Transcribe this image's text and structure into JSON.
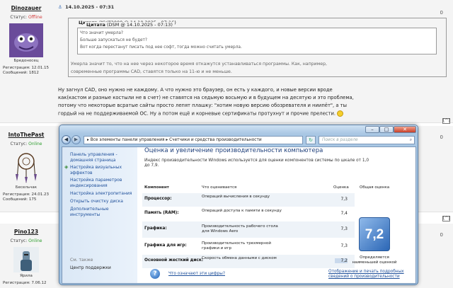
{
  "posts": [
    {
      "username": "Dinozauer",
      "status_label": "Статус:",
      "status_value": "Offline",
      "avatar_caption": "Бредоносец",
      "reg_label": "Регистрация:",
      "reg_date": "12.01.15",
      "msgs_label": "Сообщений:",
      "msgs": "1812",
      "number": "0",
      "date": "14.10.2025 - 07:31",
      "quote_outer_title": "Цитата",
      "quote_outer_meta": "(Kirill2000 @ 14.10.2025 - 07:16)",
      "quote_inner_title": "Цитата",
      "quote_inner_meta": "(DSM @ 14.10.2025 - 07:13)",
      "quote_inner_lines": [
        "Что значит умерла?",
        "Больше запускаться не будет?",
        "Вот когда перестанут писать под нее софт, тогда можно считать умерла."
      ],
      "quote_outer_lines": [
        "Умерла значит то, что на нее через некоторое время откажутся устанавливаться программы. Как, например,",
        "современные программы CAD, ставятся только на 11-ю и не меньше."
      ],
      "body_lines": [
        "Ну загнул CAD, оно нужно не каждому. А что нужно это браузер, он есть у каждого, и новые версии вроде",
        "как(кастом и разные костыли не в счет) не ставятся на седьмую восьмую и в будущем на десятую и это проблема,",
        "потому что некоторые всратые сайты просто лепят плашку: \"хотим новую версию обозревателя и ниипёт\", а ты",
        "гордый на не поддерживаемой ОС. Ну а потом ещё и корневые сертификаты протухнут и прочие прелести."
      ]
    },
    {
      "username": "IntoThePast",
      "status_label": "Статус:",
      "status_value": "Online",
      "avatar_caption": "Бесельчак",
      "reg_label": "Регистрация:",
      "reg_date": "24.01.23",
      "msgs_label": "Сообщений:",
      "msgs": "175",
      "number": "0"
    },
    {
      "username": "Pino123",
      "status_label": "Статус:",
      "status_value": "Online",
      "avatar_caption": "Ярила",
      "reg_label": "Регистрация:",
      "reg_date": "7.06.12",
      "number": "0"
    }
  ],
  "up_label": "[^]",
  "window": {
    "back_glyph": "◀",
    "forward_glyph": "▶",
    "address": "▸ Все элементы панели управления ▸ Счетчики и средства производительности",
    "refresh_glyph": "↻",
    "search_placeholder": "Поиск в разделе",
    "minimize": "–",
    "maximize": "□",
    "close": "✕",
    "left_links": [
      "Панель управления -",
      "домашняя страница",
      "Настройка визуальных",
      "эффектов",
      "Настройка параметров",
      "индексирования",
      "Настройка электропитания",
      "Открыть очистку диска",
      "Дополнительные",
      "инструменты"
    ],
    "see_also": "См. также",
    "support_center": "Центр поддержки",
    "title": "Оценка и увеличение производительности компьютера",
    "description": "Индекс производительности Windows используется для оценки компонентов системы по шкале от 1,0 до 7,9.",
    "col_component": "Компонент",
    "col_rated": "Что оценивается",
    "col_score": "Оценка",
    "col_overall": "Общая оценка",
    "rows": [
      {
        "component": "Процессор:",
        "desc": "Операций вычисления в секунду",
        "score": "7,3"
      },
      {
        "component": "Память (RAM):",
        "desc": "Операций доступа к памяти в секунду",
        "score": "7,4"
      },
      {
        "component": "Графика:",
        "desc": "Производительность рабочего стола для Windows Aero",
        "score": "7,3"
      },
      {
        "component": "Графика для игр:",
        "desc": "Производительность трехмерной графики и игр",
        "score": "7,3"
      },
      {
        "component": "Основной жесткий диск:",
        "desc": "Скорость обмена данными с диском",
        "score": "7,2"
      }
    ],
    "overall_score": "7,2",
    "overall_caption": "Определяется наименьшей оценкой",
    "help_link": "Что означают эти цифры?",
    "print_link": "Отображение и печать подробных сведений о производительности",
    "help_glyph": "?"
  }
}
